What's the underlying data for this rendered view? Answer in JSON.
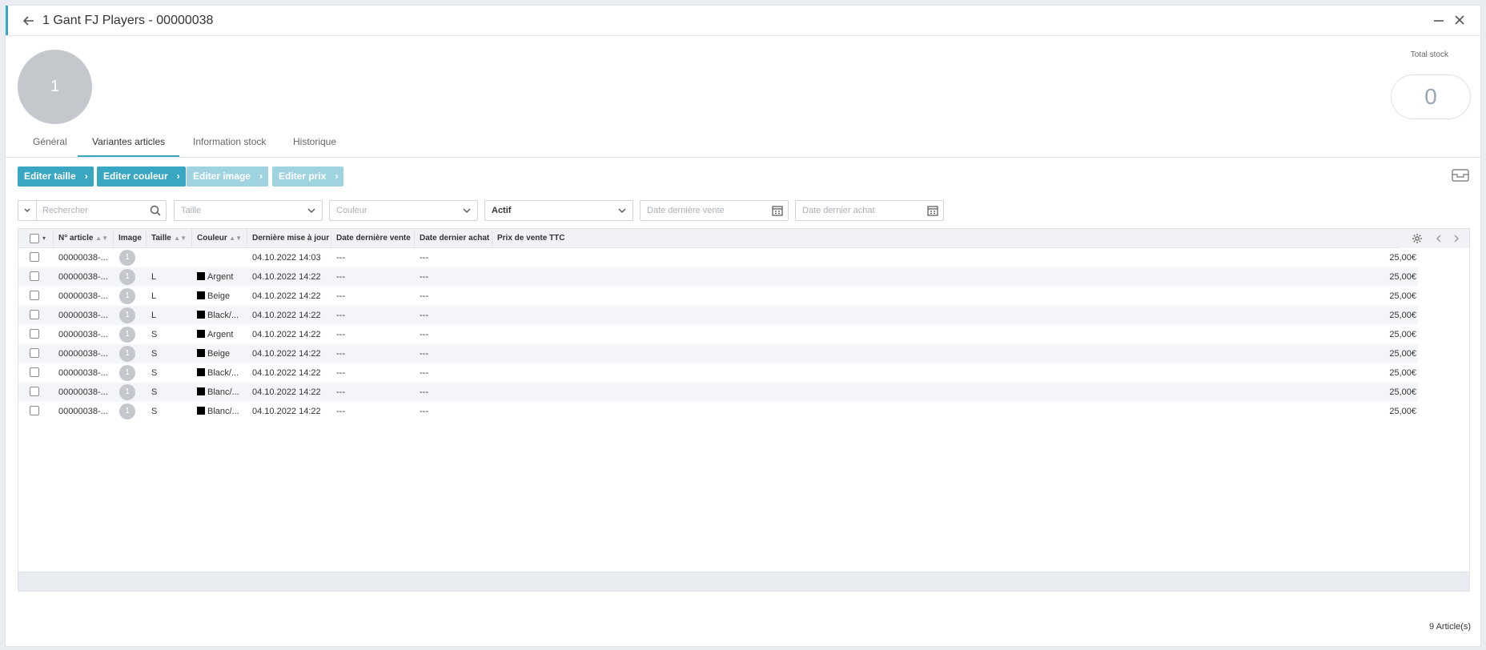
{
  "window": {
    "title": "1 Gant FJ Players - 00000038"
  },
  "avatar": {
    "text": "1"
  },
  "stock": {
    "label": "Total stock",
    "value": "0"
  },
  "tabs": [
    {
      "label": "Général"
    },
    {
      "label": "Variantes articles"
    },
    {
      "label": "Information stock"
    },
    {
      "label": "Historique"
    }
  ],
  "toolbar": {
    "edit_size": "Editer taille",
    "edit_color": "Editer couleur",
    "edit_image": "Editer image",
    "edit_price": "Editer prix"
  },
  "filters": {
    "search_placeholder": "Rechercher",
    "size_placeholder": "Taille",
    "color_placeholder": "Couleur",
    "status_value": "Actif",
    "last_sale_placeholder": "Date dernière vente",
    "last_purchase_placeholder": "Date dernier achat"
  },
  "table": {
    "columns": [
      "N° article",
      "Image",
      "Taille",
      "Couleur",
      "Dernière mise à jour",
      "Date dernière vente",
      "Date dernier achat",
      "Prix de vente TTC"
    ],
    "rows": [
      {
        "article": "00000038-...",
        "image": "1",
        "size": "",
        "color": "",
        "updated": "04.10.2022 14:03",
        "last_sale": "---",
        "last_purchase": "---",
        "price": "25,00€"
      },
      {
        "article": "00000038-...",
        "image": "1",
        "size": "L",
        "color": "Argent",
        "updated": "04.10.2022 14:22",
        "last_sale": "---",
        "last_purchase": "---",
        "price": "25,00€"
      },
      {
        "article": "00000038-...",
        "image": "1",
        "size": "L",
        "color": "Beige",
        "updated": "04.10.2022 14:22",
        "last_sale": "---",
        "last_purchase": "---",
        "price": "25,00€"
      },
      {
        "article": "00000038-...",
        "image": "1",
        "size": "L",
        "color": "Black/...",
        "updated": "04.10.2022 14:22",
        "last_sale": "---",
        "last_purchase": "---",
        "price": "25,00€"
      },
      {
        "article": "00000038-...",
        "image": "1",
        "size": "S",
        "color": "Argent",
        "updated": "04.10.2022 14:22",
        "last_sale": "---",
        "last_purchase": "---",
        "price": "25,00€"
      },
      {
        "article": "00000038-...",
        "image": "1",
        "size": "S",
        "color": "Beige",
        "updated": "04.10.2022 14:22",
        "last_sale": "---",
        "last_purchase": "---",
        "price": "25,00€"
      },
      {
        "article": "00000038-...",
        "image": "1",
        "size": "S",
        "color": "Black/...",
        "updated": "04.10.2022 14:22",
        "last_sale": "---",
        "last_purchase": "---",
        "price": "25,00€"
      },
      {
        "article": "00000038-...",
        "image": "1",
        "size": "S",
        "color": "Blanc/...",
        "updated": "04.10.2022 14:22",
        "last_sale": "---",
        "last_purchase": "---",
        "price": "25,00€"
      },
      {
        "article": "00000038-...",
        "image": "1",
        "size": "S",
        "color": "Blanc/...",
        "updated": "04.10.2022 14:22",
        "last_sale": "---",
        "last_purchase": "---",
        "price": "25,00€"
      }
    ]
  },
  "footer": {
    "count": "9 Article(s)"
  },
  "colors": {
    "accent": "#3aa7c2",
    "disabled_button": "#9fd3e0",
    "swatch": "#000000"
  }
}
